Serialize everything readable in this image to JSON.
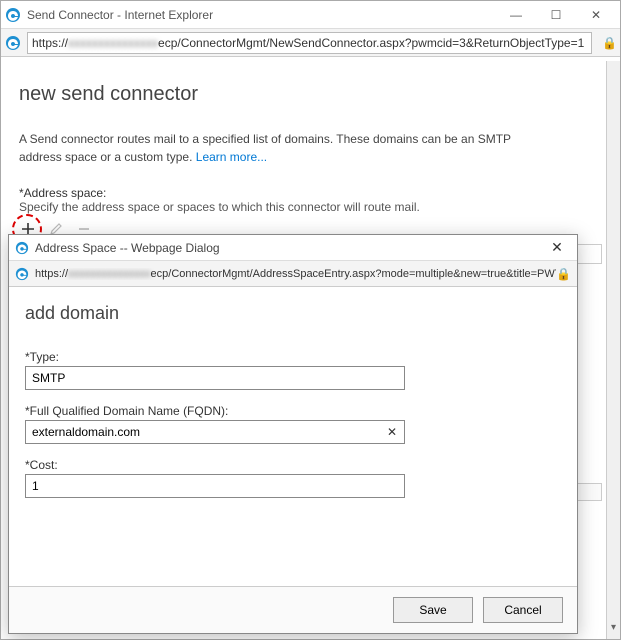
{
  "parent": {
    "window_title": "Send Connector - Internet Explorer",
    "url_prefix": "https://",
    "url_blur": "xxxxxxxxxxxxxxx",
    "url_suffix": "ecp/ConnectorMgmt/NewSendConnector.aspx?pwmcid=3&ReturnObjectType=1",
    "heading": "new send connector",
    "desc_text": "A Send connector routes mail to a specified list of domains. These domains can be an SMTP address space or a custom type. ",
    "learn_more": "Learn more...",
    "addr_label": "*Address space:",
    "addr_sub": "Specify the address space or spaces to which this connector will route mail."
  },
  "dialog": {
    "window_title": "Address Space -- Webpage Dialog",
    "url_prefix": "https://",
    "url_blur": "xxxxxxxxxxxxxxx",
    "url_suffix": "ecp/ConnectorMgmt/AddressSpaceEntry.aspx?mode=multiple&new=true&title=PWT",
    "heading": "add domain",
    "type_label": "*Type:",
    "type_value": "SMTP",
    "fqdn_label": "*Full Qualified Domain Name (FQDN):",
    "fqdn_value": "externaldomain.com",
    "cost_label": "*Cost:",
    "cost_value": "1",
    "save_label": "Save",
    "cancel_label": "Cancel"
  },
  "icons": {
    "plus": "+",
    "edit": "✎",
    "minus": "−",
    "lock": "🔒",
    "close": "✕",
    "min": "—",
    "max": "☐",
    "ie": "e"
  }
}
